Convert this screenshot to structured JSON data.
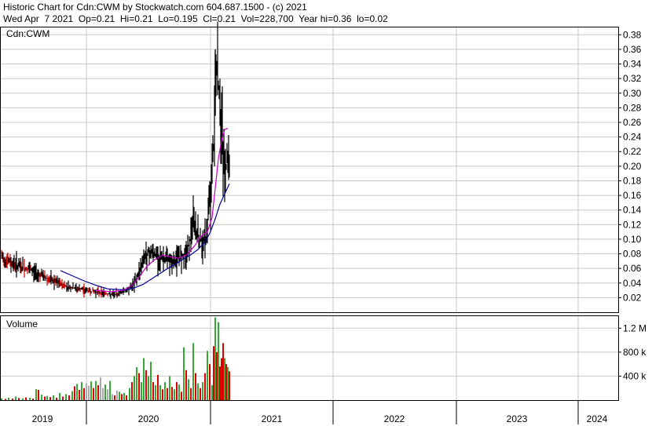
{
  "header": {
    "line1": "Historic Chart for Cdn:CWM by Stockwatch.com 604.687.1500 - (c) 2021",
    "line2": "Wed Apr  7 2021  Op=0.21  Hi=0.21  Lo=0.195  Cl=0.21  Vol=228,700  Year hi=0.36  lo=0.02"
  },
  "chart_data": {
    "type": "bar",
    "price_panel": {
      "label": "Cdn:CWM",
      "ylim": [
        0,
        0.39
      ],
      "yticks": [
        "0.02",
        "0.04",
        "0.06",
        "0.08",
        "0.10",
        "0.12",
        "0.14",
        "0.16",
        "0.18",
        "0.20",
        "0.22",
        "0.24",
        "0.26",
        "0.28",
        "0.30",
        "0.32",
        "0.34",
        "0.36",
        "0.38"
      ],
      "grid": true
    },
    "volume_panel": {
      "label": "Volume",
      "ylim": [
        0,
        1400000
      ],
      "ytick_values": [
        400000,
        800000,
        1200000
      ],
      "ytick_labels": [
        "400 k",
        "800 k",
        "1.2 M"
      ]
    },
    "x_axis": {
      "years": [
        "2019",
        "2020",
        "2021",
        "2022",
        "2023",
        "2024"
      ]
    },
    "colors": {
      "price_bar": "#000000",
      "short_ma": "#cc00cc",
      "long_ma": "#000099",
      "volume_up": "#33aa33",
      "volume_down": "#dd0000",
      "volume_neutral": "#aaaaaa",
      "grid": "#c8c8c8"
    },
    "price_path": [
      [
        0,
        0.075
      ],
      [
        12,
        0.068
      ],
      [
        24,
        0.062
      ],
      [
        36,
        0.058
      ],
      [
        48,
        0.052
      ],
      [
        60,
        0.045
      ],
      [
        72,
        0.04
      ],
      [
        84,
        0.035
      ],
      [
        96,
        0.032
      ],
      [
        108,
        0.03
      ],
      [
        120,
        0.028
      ],
      [
        132,
        0.026
      ],
      [
        140,
        0.024
      ],
      [
        148,
        0.025
      ],
      [
        155,
        0.029
      ],
      [
        162,
        0.033
      ],
      [
        168,
        0.038
      ],
      [
        173,
        0.05
      ],
      [
        178,
        0.065
      ],
      [
        183,
        0.078
      ],
      [
        188,
        0.083
      ],
      [
        193,
        0.08
      ],
      [
        198,
        0.077
      ],
      [
        203,
        0.075
      ],
      [
        208,
        0.073
      ],
      [
        213,
        0.07
      ],
      [
        218,
        0.069
      ],
      [
        223,
        0.071
      ],
      [
        228,
        0.077
      ],
      [
        232,
        0.08
      ],
      [
        236,
        0.083
      ],
      [
        240,
        0.1
      ],
      [
        244,
        0.12
      ],
      [
        248,
        0.11
      ],
      [
        252,
        0.1
      ],
      [
        256,
        0.095
      ],
      [
        260,
        0.1
      ],
      [
        264,
        0.14
      ],
      [
        267,
        0.18
      ],
      [
        270,
        0.23
      ],
      [
        272,
        0.29
      ],
      [
        274,
        0.33
      ],
      [
        276,
        0.31
      ],
      [
        278,
        0.28
      ],
      [
        280,
        0.25
      ],
      [
        282,
        0.22
      ],
      [
        284,
        0.19
      ],
      [
        286,
        0.2
      ],
      [
        288,
        0.215
      ],
      [
        290,
        0.21
      ]
    ],
    "short_ma": [
      [
        120,
        0.03
      ],
      [
        140,
        0.028
      ],
      [
        155,
        0.03
      ],
      [
        165,
        0.036
      ],
      [
        175,
        0.048
      ],
      [
        185,
        0.063
      ],
      [
        195,
        0.072
      ],
      [
        205,
        0.078
      ],
      [
        215,
        0.076
      ],
      [
        225,
        0.074
      ],
      [
        235,
        0.078
      ],
      [
        245,
        0.09
      ],
      [
        255,
        0.105
      ],
      [
        262,
        0.11
      ],
      [
        268,
        0.13
      ],
      [
        272,
        0.17
      ],
      [
        276,
        0.21
      ],
      [
        280,
        0.235
      ],
      [
        284,
        0.25
      ],
      [
        288,
        0.252
      ]
    ],
    "long_ma": [
      [
        75,
        0.057
      ],
      [
        90,
        0.05
      ],
      [
        105,
        0.043
      ],
      [
        120,
        0.037
      ],
      [
        135,
        0.032
      ],
      [
        150,
        0.031
      ],
      [
        160,
        0.031
      ],
      [
        170,
        0.034
      ],
      [
        180,
        0.038
      ],
      [
        190,
        0.045
      ],
      [
        200,
        0.052
      ],
      [
        210,
        0.059
      ],
      [
        220,
        0.065
      ],
      [
        230,
        0.072
      ],
      [
        240,
        0.078
      ],
      [
        250,
        0.086
      ],
      [
        258,
        0.095
      ],
      [
        265,
        0.108
      ],
      [
        272,
        0.128
      ],
      [
        278,
        0.148
      ],
      [
        284,
        0.162
      ],
      [
        290,
        0.176
      ]
    ],
    "volume_series": [
      [
        0,
        30000,
        "up"
      ],
      [
        5,
        20000,
        "down"
      ],
      [
        9,
        40000,
        "up"
      ],
      [
        14,
        25000,
        "down"
      ],
      [
        18,
        60000,
        "up"
      ],
      [
        22,
        35000,
        "down"
      ],
      [
        27,
        30000,
        "up"
      ],
      [
        31,
        45000,
        "down"
      ],
      [
        36,
        40000,
        "up"
      ],
      [
        40,
        25000,
        "down"
      ],
      [
        44,
        180000,
        "up"
      ],
      [
        47,
        170000,
        "down"
      ],
      [
        51,
        90000,
        "up"
      ],
      [
        55,
        60000,
        "down"
      ],
      [
        58,
        70000,
        "up"
      ],
      [
        62,
        50000,
        "down"
      ],
      [
        66,
        80000,
        "up"
      ],
      [
        70,
        40000,
        "down"
      ],
      [
        74,
        120000,
        "up"
      ],
      [
        78,
        60000,
        "down"
      ],
      [
        82,
        100000,
        "up"
      ],
      [
        86,
        80000,
        "down"
      ],
      [
        90,
        150000,
        "up"
      ],
      [
        93,
        230000,
        "down"
      ],
      [
        96,
        270000,
        "up"
      ],
      [
        99,
        170000,
        "down"
      ],
      [
        102,
        300000,
        "up"
      ],
      [
        105,
        200000,
        "down"
      ],
      [
        108,
        280000,
        "neutral"
      ],
      [
        111,
        240000,
        "neutral"
      ],
      [
        114,
        310000,
        "up"
      ],
      [
        117,
        200000,
        "down"
      ],
      [
        120,
        320000,
        "up"
      ],
      [
        123,
        250000,
        "down"
      ],
      [
        126,
        380000,
        "neutral"
      ],
      [
        129,
        200000,
        "neutral"
      ],
      [
        132,
        260000,
        "up"
      ],
      [
        135,
        180000,
        "neutral"
      ],
      [
        138,
        320000,
        "up"
      ],
      [
        141,
        100000,
        "neutral"
      ],
      [
        144,
        80000,
        "down"
      ],
      [
        147,
        160000,
        "neutral"
      ],
      [
        150,
        140000,
        "up"
      ],
      [
        153,
        100000,
        "down"
      ],
      [
        156,
        120000,
        "up"
      ],
      [
        159,
        80000,
        "down"
      ],
      [
        163,
        200000,
        "up"
      ],
      [
        166,
        300000,
        "down"
      ],
      [
        169,
        400000,
        "up"
      ],
      [
        172,
        550000,
        "green"
      ],
      [
        175,
        450000,
        "down"
      ],
      [
        178,
        300000,
        "up"
      ],
      [
        181,
        700000,
        "up"
      ],
      [
        184,
        500000,
        "down"
      ],
      [
        187,
        400000,
        "up"
      ],
      [
        190,
        640000,
        "up"
      ],
      [
        193,
        300000,
        "down"
      ],
      [
        196,
        250000,
        "up"
      ],
      [
        199,
        420000,
        "down"
      ],
      [
        202,
        250000,
        "up"
      ],
      [
        205,
        180000,
        "down"
      ],
      [
        208,
        300000,
        "up"
      ],
      [
        211,
        200000,
        "down"
      ],
      [
        214,
        400000,
        "up"
      ],
      [
        217,
        220000,
        "down"
      ],
      [
        220,
        180000,
        "up"
      ],
      [
        223,
        300000,
        "down"
      ],
      [
        226,
        260000,
        "up"
      ],
      [
        229,
        140000,
        "down"
      ],
      [
        232,
        880000,
        "up"
      ],
      [
        235,
        500000,
        "down"
      ],
      [
        238,
        350000,
        "up"
      ],
      [
        241,
        200000,
        "down"
      ],
      [
        244,
        950000,
        "up"
      ],
      [
        247,
        450000,
        "down"
      ],
      [
        250,
        280000,
        "up"
      ],
      [
        253,
        200000,
        "down"
      ],
      [
        256,
        300000,
        "up"
      ],
      [
        259,
        450000,
        "down"
      ],
      [
        262,
        820000,
        "up"
      ],
      [
        265,
        600000,
        "down"
      ],
      [
        268,
        250000,
        "up"
      ],
      [
        270,
        900000,
        "down"
      ],
      [
        272,
        1380000,
        "up"
      ],
      [
        274,
        800000,
        "down"
      ],
      [
        276,
        1300000,
        "up"
      ],
      [
        278,
        560000,
        "down"
      ],
      [
        280,
        700000,
        "down"
      ],
      [
        282,
        950000,
        "down"
      ],
      [
        284,
        700000,
        "up"
      ],
      [
        286,
        600000,
        "down"
      ],
      [
        288,
        550000,
        "up"
      ],
      [
        290,
        480000,
        "down"
      ]
    ]
  }
}
